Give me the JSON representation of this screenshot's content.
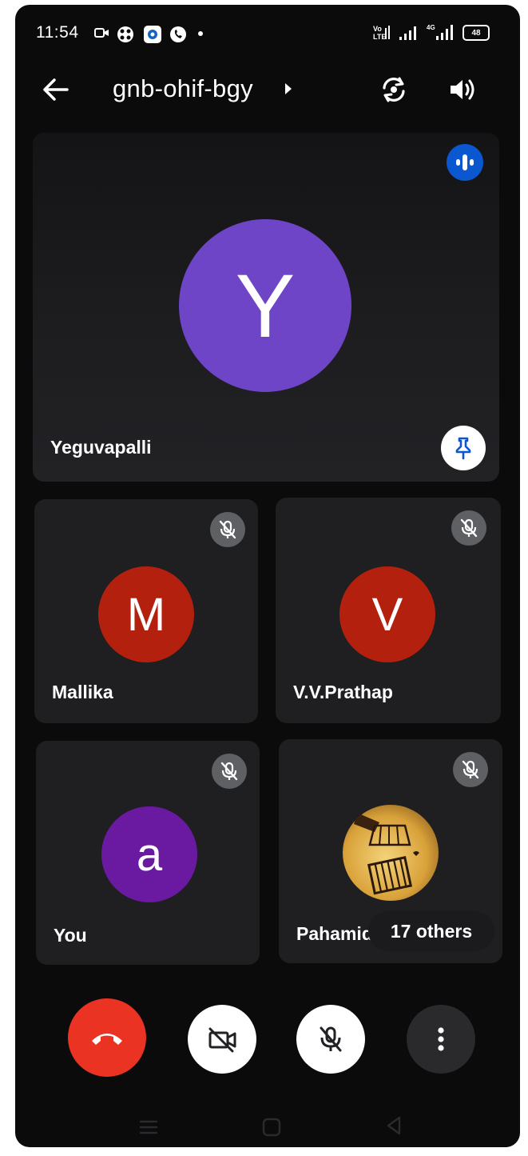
{
  "status_bar": {
    "time": "11:54",
    "battery": "48",
    "icons": [
      "video-notification-icon",
      "app-notification-icon",
      "screen-record-icon",
      "phone-call-icon",
      "dot-icon",
      "volte-icon",
      "signal-icon",
      "signal-4g-icon",
      "battery-icon"
    ]
  },
  "header": {
    "meeting_code": "gnb-ohif-bgy",
    "icons": [
      "back-arrow-icon",
      "caret-right-icon",
      "switch-camera-icon",
      "speaker-icon"
    ]
  },
  "main_tile": {
    "initial": "Y",
    "name": "Yeguvapalli",
    "avatar_color": "#6e45c6",
    "indicator_color": "#0b57d0"
  },
  "tiles": [
    {
      "initial": "M",
      "name": "Mallika",
      "avatar_color": "#b3200e",
      "muted": true
    },
    {
      "initial": "V",
      "name": "V.V.Prathap",
      "avatar_color": "#b3200e",
      "muted": true
    },
    {
      "initial": "a",
      "name": "You",
      "avatar_color": "#6a1aa1",
      "muted": true
    },
    {
      "initial": "",
      "name": "Pahamida",
      "avatar_color": "#d9a23a",
      "muted": true
    }
  ],
  "others_label": "17 others",
  "controls": {
    "end_call_color": "#ea3323",
    "icons": [
      "end-call-icon",
      "camera-off-icon",
      "mic-off-icon",
      "more-vert-icon"
    ]
  },
  "nav": {
    "icons": [
      "recents-icon",
      "home-icon",
      "back-icon"
    ]
  }
}
